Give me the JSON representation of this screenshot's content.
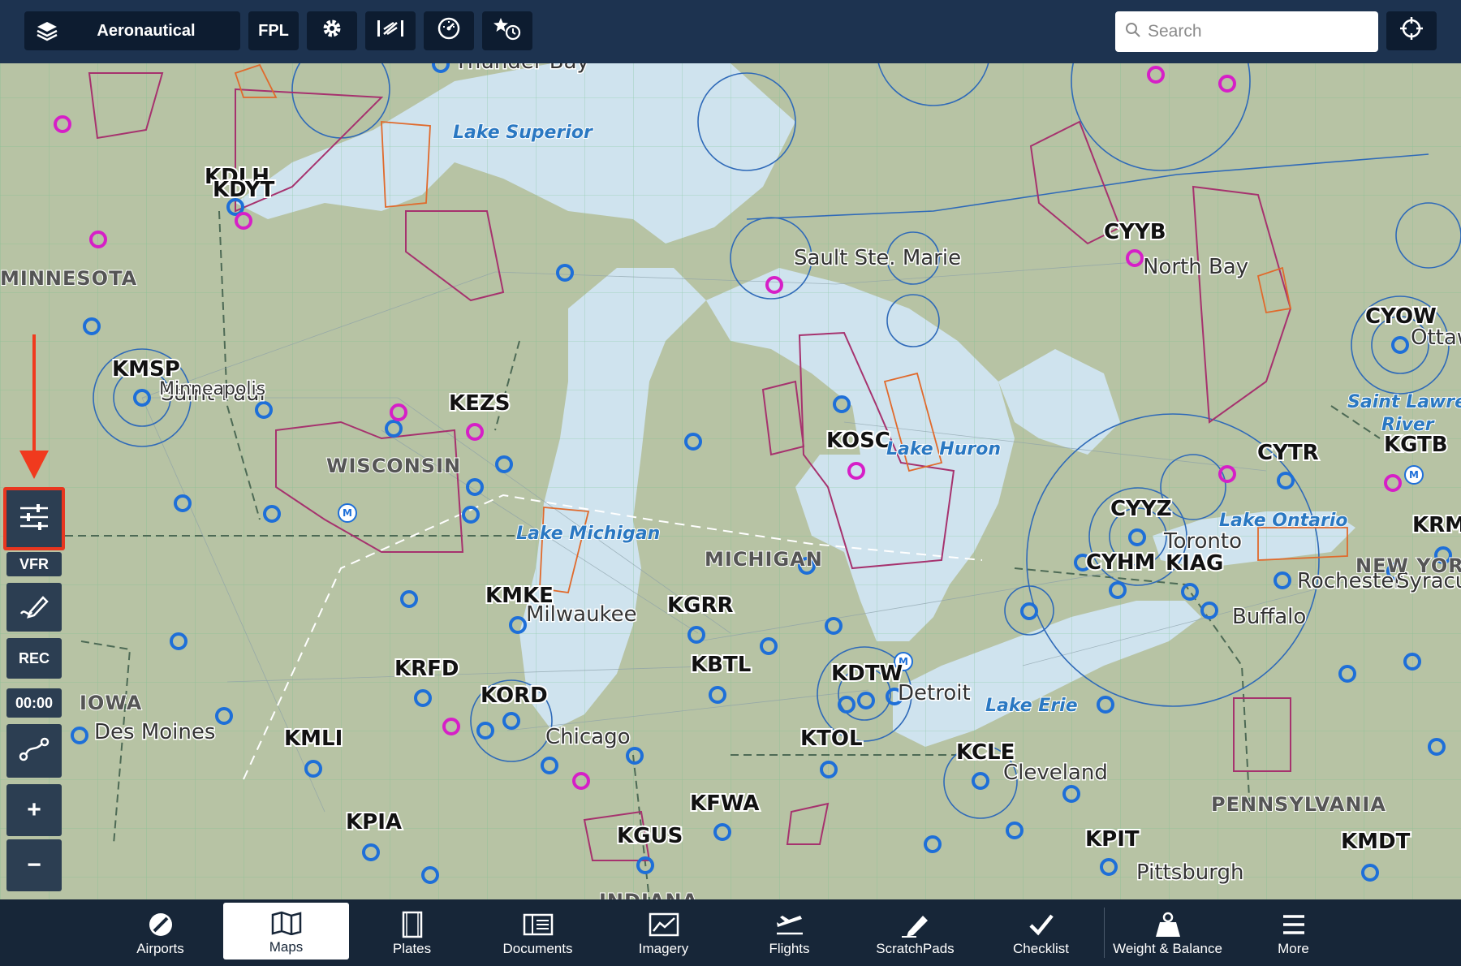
{
  "toolbar": {
    "layer_label": "Aeronautical",
    "fpl_label": "FPL",
    "search_placeholder": "Search"
  },
  "left_toolbar": {
    "mode_label": "VFR",
    "rec_label": "REC",
    "timer": "00:00",
    "zoom_in": "+",
    "zoom_out": "−"
  },
  "tabs": [
    {
      "label": "Airports",
      "icon": "airport-icon"
    },
    {
      "label": "Maps",
      "icon": "map-icon",
      "active": true
    },
    {
      "label": "Plates",
      "icon": "plates-icon"
    },
    {
      "label": "Documents",
      "icon": "documents-icon"
    },
    {
      "label": "Imagery",
      "icon": "imagery-icon"
    },
    {
      "label": "Flights",
      "icon": "flights-icon"
    },
    {
      "label": "ScratchPads",
      "icon": "scratchpad-icon"
    },
    {
      "label": "Checklist",
      "icon": "checklist-icon"
    },
    {
      "label": "Weight & Balance",
      "icon": "weight-icon"
    },
    {
      "label": "More",
      "icon": "more-icon"
    }
  ],
  "map": {
    "airports": [
      "KDLH",
      "KDYT",
      "KMSP",
      "KEZS",
      "KMKE",
      "KGRR",
      "KRFD",
      "KBTL",
      "KORD",
      "KMLI",
      "KPIA",
      "KGUS",
      "KFWA",
      "KDTW",
      "KTOL",
      "KCLE",
      "KPIT",
      "KMDT",
      "KOSC",
      "CYYB",
      "CYOW",
      "CYTR",
      "KGTB",
      "CYYZ",
      "CYHM",
      "KIAG",
      "KRM"
    ],
    "cities": [
      "Thunder Bay",
      "Sault Ste. Marie",
      "North Bay",
      "Ottawa",
      "Saint Paul",
      "Minneapolis",
      "Milwaukee",
      "Chicago",
      "Des Moines",
      "Detroit",
      "Cleveland",
      "Toronto",
      "Buffalo",
      "Rochester",
      "Syracuse",
      "Pittsburgh"
    ],
    "states": [
      "MINNESOTA",
      "WISCONSIN",
      "MICHIGAN",
      "IOWA",
      "PENNSYLVANIA",
      "NEW YORK",
      "INDIANA"
    ],
    "water": [
      "Lake Superior",
      "Lake Michigan",
      "Lake Huron",
      "Lake Ontario",
      "Lake Erie",
      "Saint Lawrence",
      "River"
    ]
  }
}
